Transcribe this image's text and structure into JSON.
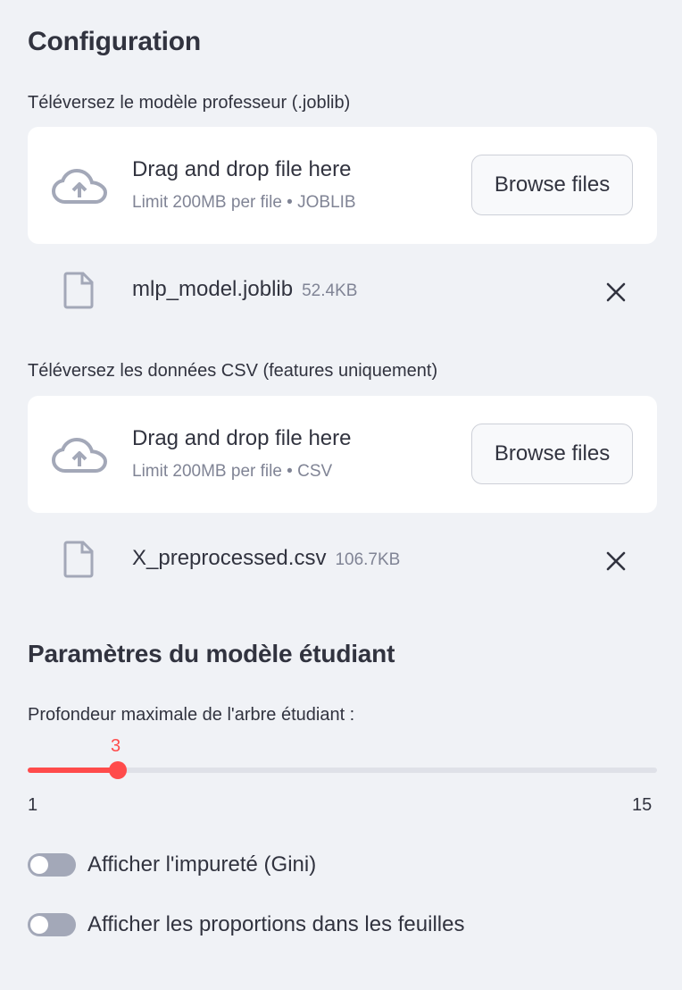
{
  "sidebar": {
    "title": "Configuration",
    "teacher_upload": {
      "label": "Téléversez le modèle professeur (.joblib)",
      "dropzone_title": "Drag and drop file here",
      "dropzone_limit": "Limit 200MB per file • JOBLIB",
      "browse_label": "Browse files",
      "file": {
        "name": "mlp_model.joblib",
        "size": "52.4KB"
      }
    },
    "data_upload": {
      "label": "Téléversez les données CSV (features uniquement)",
      "dropzone_title": "Drag and drop file here",
      "dropzone_limit": "Limit 200MB per file • CSV",
      "browse_label": "Browse files",
      "file": {
        "name": "X_preprocessed.csv",
        "size": "106.7KB"
      }
    },
    "student_params": {
      "title": "Paramètres du modèle étudiant",
      "depth_slider": {
        "label": "Profondeur maximale de l'arbre étudiant :",
        "value": "3",
        "min": "1",
        "max": "15",
        "fill_fraction": 0.1428
      },
      "toggles": [
        {
          "label": "Afficher l'impureté (Gini)",
          "checked": false
        },
        {
          "label": "Afficher les proportions dans les feuilles",
          "checked": false
        }
      ]
    }
  },
  "icons": {
    "upload": "cloud-upload-icon",
    "file": "file-icon",
    "close": "close-icon"
  },
  "colors": {
    "accent": "#ff4b4b",
    "background": "#f0f2f6",
    "card": "#ffffff",
    "muted_text": "#808495",
    "toggle_off": "#a3a8b8"
  }
}
